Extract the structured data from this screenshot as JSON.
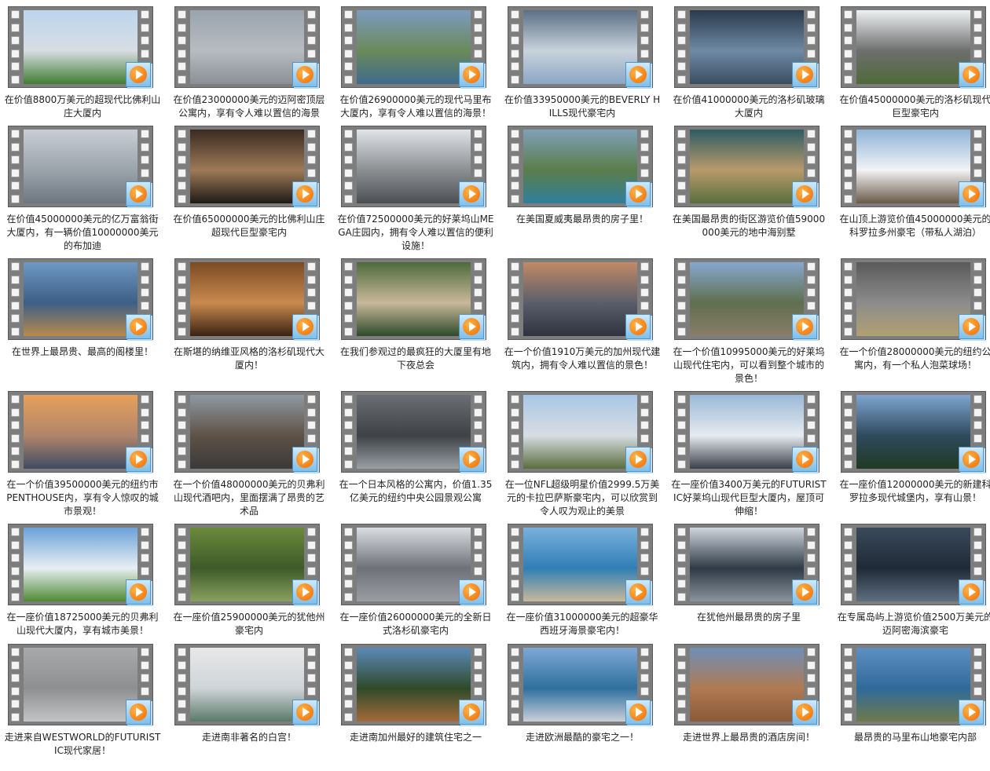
{
  "colors": {
    "film_strip": "#7d7d7d",
    "film_hole": "#f4f4f4",
    "play_badge_bg": "#9fd0f1",
    "play_circle": "#f47a10",
    "caption_text": "#222222"
  },
  "video_icon": "video-file-icon",
  "play_icon": "play-icon",
  "items": [
    {
      "title": "在价值8800万美元的超现代比佛利山庄大厦内",
      "thumb": [
        "#bcd6ee",
        "#d8dde2",
        "#3f7d32"
      ]
    },
    {
      "title": "在价值23000000美元的迈阿密顶层公寓内，享有令人难以置信的海景",
      "thumb": [
        "#9aa4ad",
        "#b7bcc1",
        "#8a9096"
      ]
    },
    {
      "title": "在价值26900000美元的现代马里布大厦内，享有令人难以置信的海景！",
      "thumb": [
        "#7c9bbf",
        "#6b8a5a",
        "#3e6b8c"
      ]
    },
    {
      "title": "在价值33950000美元的BEVERLY HILLS现代豪宅内",
      "thumb": [
        "#5b6f86",
        "#c9d3dc",
        "#8aa6c4"
      ]
    },
    {
      "title": "在价值41000000美元的洛杉矶玻璃大厦内",
      "thumb": [
        "#2a3a4c",
        "#6f8aa4",
        "#3a4d60"
      ]
    },
    {
      "title": "在价值45000000美元的洛杉矶现代巨型豪宅内",
      "thumb": [
        "#eef1f3",
        "#6e6e6e",
        "#4f6a3a"
      ]
    },
    {
      "title": "在价值45000000美元的亿万富翁街大厦内，有一辆价值10000000美元的布加迪",
      "thumb": [
        "#c8ced4",
        "#9ba3ab",
        "#6e7781"
      ]
    },
    {
      "title": "在价值65000000美元的比佛利山庄超现代巨型豪宅内",
      "thumb": [
        "#3a2a20",
        "#9d7a58",
        "#1f1a16"
      ]
    },
    {
      "title": "在价值72500000美元的好莱坞山MEGA庄园内，拥有令人难以置信的便利设施！",
      "thumb": [
        "#e0e4e8",
        "#8c8f92",
        "#4b4f53"
      ]
    },
    {
      "title": "在美国夏威夷最昂贵的房子里！",
      "thumb": [
        "#7fa0b8",
        "#5b7d4a",
        "#2f7f9c"
      ]
    },
    {
      "title": "在美国最昂贵的街区游览价值59000000美元的地中海别墅",
      "thumb": [
        "#2f5c63",
        "#b89a6a",
        "#5a6e3c"
      ]
    },
    {
      "title": "在山顶上游览价值45000000美元的科罗拉多州豪宅（带私人湖泊）",
      "thumb": [
        "#8fb4d8",
        "#f1f3f5",
        "#6b5a48"
      ]
    },
    {
      "title": "在世界上最昂贵、最高的阁楼里！",
      "thumb": [
        "#6f98c4",
        "#3d5f86",
        "#b88a4e"
      ]
    },
    {
      "title": "在斯堪的纳维亚风格的洛杉矶现代大厦内！",
      "thumb": [
        "#7a4a24",
        "#c98a4e",
        "#3a2212"
      ]
    },
    {
      "title": "在我们参观过的最疯狂的大厦里有地下夜总会",
      "thumb": [
        "#4e6a3c",
        "#c8b89a",
        "#2c4a2a"
      ]
    },
    {
      "title": "在一个价值1910万美元的加州现代建筑内，拥有令人难以置信的景色！",
      "thumb": [
        "#c28a66",
        "#5b5e6a",
        "#2e3240"
      ]
    },
    {
      "title": "在一个价值10995000美元的好莱坞山现代住宅内，可以看到整个城市的景色！",
      "thumb": [
        "#86a8cf",
        "#5f6f4e",
        "#8a7d6a"
      ]
    },
    {
      "title": "在一个价值28000000美元的纽约公寓内，有一个私人泡菜球场！",
      "thumb": [
        "#5a5a5a",
        "#8c8c8c",
        "#b0a070"
      ]
    },
    {
      "title": "在一个价值39500000美元的纽约市PENTHOUSE内，享有令人惊叹的城市景观！",
      "thumb": [
        "#e8a05a",
        "#b0856a",
        "#3f4c63"
      ]
    },
    {
      "title": "在一个价值48000000美元的贝弗利山现代酒吧内，里面摆满了昂贵的艺术品",
      "thumb": [
        "#8f99a3",
        "#5e5246",
        "#3a3a3a"
      ]
    },
    {
      "title": "在一个日本风格的公寓内，价值1.35亿美元的纽约中央公园景观公寓",
      "thumb": [
        "#6b6f73",
        "#3e4246",
        "#9a9fa4"
      ]
    },
    {
      "title": "在一位NFL超级明星价值2999.5万美元的卡拉巴萨斯豪宅内，可以欣赏到令人叹为观止的美景",
      "thumb": [
        "#a9c6e6",
        "#d7dde4",
        "#5a6e3c"
      ]
    },
    {
      "title": "在一座价值3400万美元的FUTURISTIC好莱坞山现代巨型大厦内，屋顶可伸缩！",
      "thumb": [
        "#9ab8d8",
        "#e6ebf0",
        "#3a4048"
      ]
    },
    {
      "title": "在一座价值12000000美元的新建科罗拉多现代城堡内，享有山景！",
      "thumb": [
        "#7fa6d0",
        "#2f4a5e",
        "#1f3a22"
      ]
    },
    {
      "title": "在一座价值18725000美元的贝弗利山现代大厦内，享有城市美景！",
      "thumb": [
        "#6aa2d8",
        "#e8eef2",
        "#4f8a34"
      ]
    },
    {
      "title": "在一座价值25900000美元的犹他州豪宅内",
      "thumb": [
        "#6b8a3a",
        "#3e5a2a",
        "#8aa060"
      ]
    },
    {
      "title": "在一座价值26000000美元的全新日式洛杉矶豪宅内",
      "thumb": [
        "#d9dde1",
        "#6e7278",
        "#9a9ea3"
      ]
    },
    {
      "title": "在一座价值31000000美元的超豪华西班牙海景豪宅内！",
      "thumb": [
        "#7ab0dc",
        "#2f7fb5",
        "#c8b89a"
      ]
    },
    {
      "title": "在犹他州最昂贵的房子里",
      "thumb": [
        "#cfd6dd",
        "#2f3a46",
        "#8a939c"
      ]
    },
    {
      "title": "在专属岛屿上游览价值2500万美元的迈阿密海滨豪宅",
      "thumb": [
        "#3a4a5a",
        "#1f2a36",
        "#5f6f80"
      ]
    },
    {
      "title": "走进来自WESTWORLD的FUTURISTIC现代家居！",
      "thumb": [
        "#a8aaab",
        "#8d8f90",
        "#c2c4c5"
      ]
    },
    {
      "title": "走进南非著名的白宫！",
      "thumb": [
        "#e8e8e8",
        "#cfd4d8",
        "#5a7a6a"
      ]
    },
    {
      "title": "走进南加州最好的建筑住宅之一",
      "thumb": [
        "#5c8ab8",
        "#2f4a2a",
        "#a36a3a"
      ]
    },
    {
      "title": "走进欧洲最酷的豪宅之一！",
      "thumb": [
        "#7fa8d4",
        "#2f6f9e",
        "#c8d0d8"
      ]
    },
    {
      "title": "走进世界上最昂贵的酒店房间！",
      "thumb": [
        "#6e8fb8",
        "#b07a52",
        "#8a5a3a"
      ]
    },
    {
      "title": "最昂贵的马里布山地豪宅内部",
      "thumb": [
        "#5f8fc4",
        "#2f6a9a",
        "#6e7a4a"
      ]
    }
  ]
}
